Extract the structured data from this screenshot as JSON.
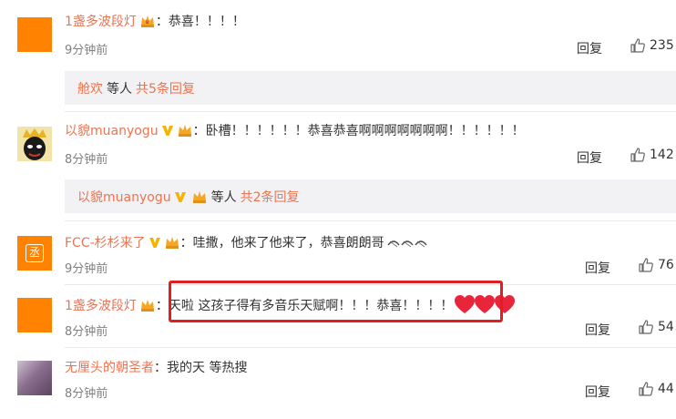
{
  "comments": [
    {
      "user": "1盏多波段灯",
      "text": "：恭喜！！！！",
      "time": "9分钟前",
      "reply": "回复",
      "likes": "235"
    },
    {
      "user": "以貌muanyogu",
      "text": "：卧槽！！！！！！恭喜恭喜啊啊啊啊啊啊啊！！！！！！",
      "time": "8分钟前",
      "reply": "回复",
      "likes": "142"
    },
    {
      "user": "FCC-杉杉来了",
      "text": "：哇撒，他来了他来了，恭喜朗朗哥",
      "time": "9分钟前",
      "reply": "回复",
      "likes": "76"
    },
    {
      "user": "1盏多波段灯",
      "text": "：天啦 这孩子得有多音乐天赋啊！！！恭喜！！！！",
      "time": "8分钟前",
      "reply": "回复",
      "likes": "54"
    },
    {
      "user": "无厘头的朝圣者",
      "text": "：我的天 等热搜",
      "time": "8分钟前",
      "reply": "回复",
      "likes": "44"
    }
  ],
  "subreplies": [
    {
      "name": "舱欢",
      "text": "等人",
      "link": "共5条回复"
    },
    {
      "name": "以貌muanyogu",
      "text": "等人",
      "link": "共2条回复"
    }
  ],
  "avatars": {
    "fcc_letter": "丞"
  },
  "colors": {
    "username": "#eb7350",
    "highlight_border": "#e02020",
    "avatar_orange": "#ff8200"
  }
}
